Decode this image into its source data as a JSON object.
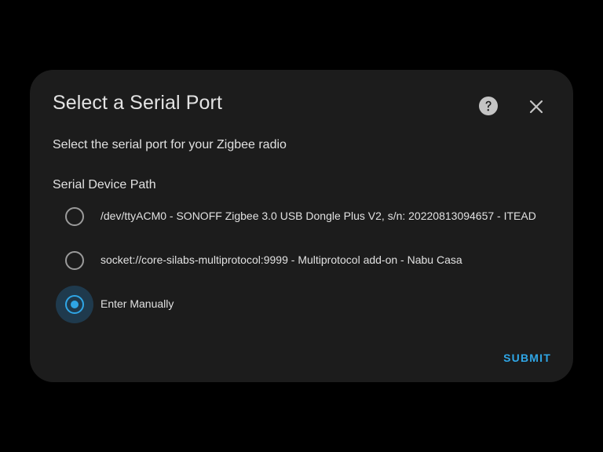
{
  "dialog": {
    "title": "Select a Serial Port",
    "description": "Select the serial port for your Zigbee radio",
    "help_icon": "help-circle-icon",
    "close_icon": "close-icon",
    "field_label": "Serial Device Path",
    "options": [
      {
        "label": "/dev/ttyACM0 - SONOFF Zigbee 3.0 USB Dongle Plus V2, s/n: 20220813094657 - ITEAD",
        "checked": false
      },
      {
        "label": "socket://core-silabs-multiprotocol:9999 - Multiprotocol add-on - Nabu Casa",
        "checked": false
      },
      {
        "label": "Enter Manually",
        "checked": true
      }
    ],
    "submit_label": "SUBMIT"
  },
  "colors": {
    "background": "#000000",
    "dialog": "#1c1c1c",
    "accent": "#2fa6e6",
    "text": "#e1e1e1",
    "radio_unchecked": "#9b9b9b"
  }
}
